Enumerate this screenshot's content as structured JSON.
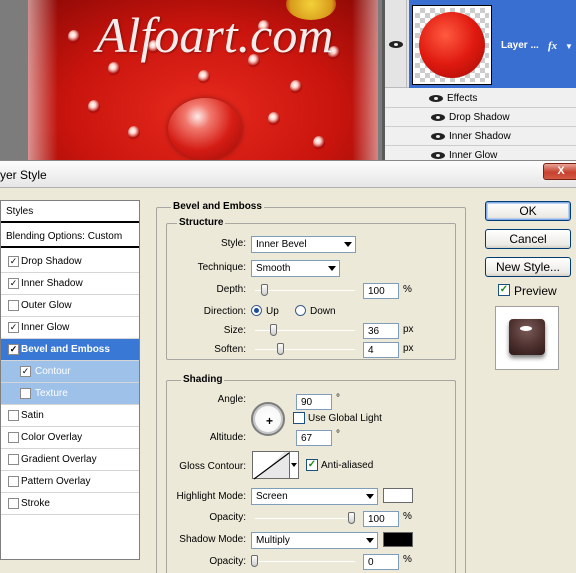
{
  "canvas": {
    "watermark": "Alfoart.com"
  },
  "layers_panel": {
    "layer_name": "Layer ...",
    "fx_icon": "fx",
    "effects_label": "Effects",
    "effects": [
      "Drop Shadow",
      "Inner Shadow",
      "Inner Glow"
    ]
  },
  "dialog": {
    "title": "yer Style",
    "close_label": "X"
  },
  "styles_list": {
    "header": "Styles",
    "blending": "Blending Options: Custom",
    "items": [
      {
        "label": "Drop Shadow",
        "checked": true
      },
      {
        "label": "Inner Shadow",
        "checked": true
      },
      {
        "label": "Outer Glow",
        "checked": false
      },
      {
        "label": "Inner Glow",
        "checked": true
      },
      {
        "label": "Bevel and Emboss",
        "checked": true,
        "active": true
      },
      {
        "label": "Contour",
        "checked": true,
        "sub": true
      },
      {
        "label": "Texture",
        "checked": false,
        "sub": true
      },
      {
        "label": "Satin",
        "checked": false
      },
      {
        "label": "Color Overlay",
        "checked": false
      },
      {
        "label": "Gradient Overlay",
        "checked": false
      },
      {
        "label": "Pattern Overlay",
        "checked": false
      },
      {
        "label": "Stroke",
        "checked": false
      }
    ]
  },
  "bevel": {
    "title": "Bevel and Emboss",
    "structure": {
      "title": "Structure",
      "style_label": "Style:",
      "style_value": "Inner Bevel",
      "technique_label": "Technique:",
      "technique_value": "Smooth",
      "depth_label": "Depth:",
      "depth_value": "100",
      "depth_unit": "%",
      "depth_level": 0.08,
      "direction_label": "Direction:",
      "direction_up": "Up",
      "direction_down": "Down",
      "direction_selected": "Up",
      "size_label": "Size:",
      "size_value": "36",
      "size_unit": "px",
      "soften_label": "Soften:",
      "soften_value": "4",
      "soften_unit": "px"
    },
    "shading": {
      "title": "Shading",
      "angle_label": "Angle:",
      "angle_value": "90",
      "angle_unit": "°",
      "global_light_label": "Use Global Light",
      "global_light_checked": false,
      "altitude_label": "Altitude:",
      "altitude_value": "67",
      "altitude_unit": "°",
      "gloss_label": "Gloss Contour:",
      "anti_aliased_label": "Anti-aliased",
      "anti_aliased_checked": true,
      "highlight_mode_label": "Highlight Mode:",
      "highlight_mode_value": "Screen",
      "highlight_color": "#ffffff",
      "highlight_opacity_label": "Opacity:",
      "highlight_opacity_value": "100",
      "highlight_opacity_unit": "%",
      "shadow_mode_label": "Shadow Mode:",
      "shadow_mode_value": "Multiply",
      "shadow_color": "#000000",
      "shadow_opacity_label": "Opacity:",
      "shadow_opacity_value": "0",
      "shadow_opacity_unit": "%"
    }
  },
  "buttons": {
    "ok": "OK",
    "cancel": "Cancel",
    "new_style": "New Style...",
    "preview_label": "Preview",
    "preview_checked": true
  }
}
